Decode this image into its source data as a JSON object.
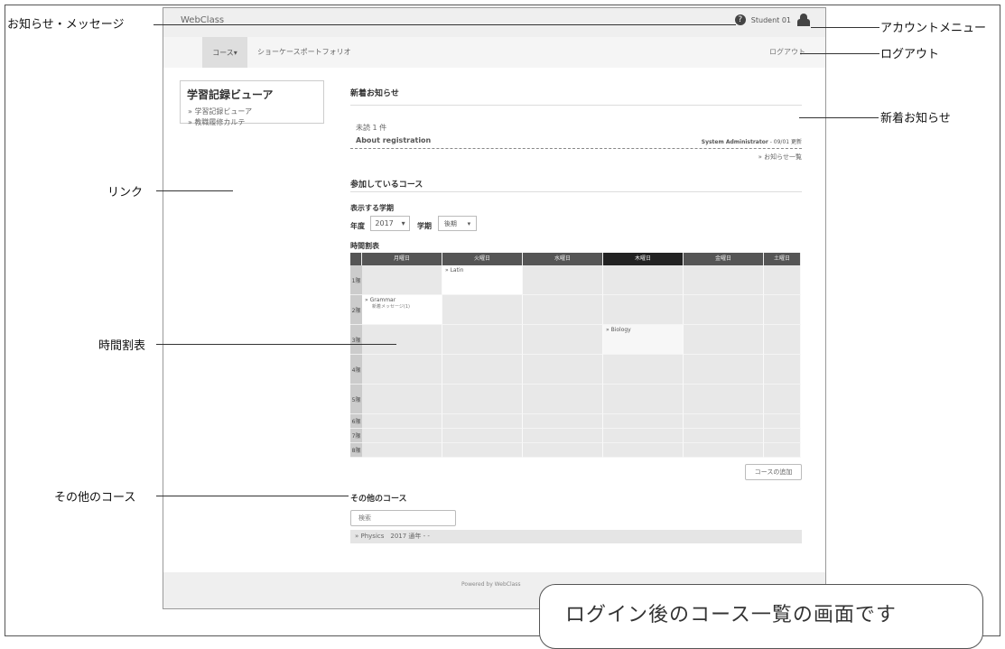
{
  "app": {
    "brand": "WebClass"
  },
  "account": {
    "user": "Student 01"
  },
  "nav": {
    "courses": "コース▾",
    "showcase": "ショーケースポートフォリオ",
    "logout": "ログアウト"
  },
  "sidebar": {
    "title": "学習記録ビューア",
    "links": [
      "» 学習記録ビューア",
      "» 教職履修カルテ"
    ]
  },
  "news": {
    "heading": "新着お知らせ",
    "unread": "未読 1 件",
    "item_title": "About registration",
    "item_author": "System Administrator",
    "item_meta": " - 09/01 更新",
    "list_link": "» お知らせ一覧"
  },
  "courses": {
    "heading": "参加しているコース",
    "term_heading": "表示する学期",
    "year_label": "年度",
    "year_value": "2017",
    "term_label": "学期",
    "term_value": "後期"
  },
  "timetable": {
    "heading": "時間割表",
    "days": [
      "月曜日",
      "火曜日",
      "水曜日",
      "木曜日",
      "金曜日",
      "土曜日"
    ],
    "periods": [
      "1限",
      "2限",
      "3限",
      "4限",
      "5限",
      "6限",
      "7限",
      "8限"
    ],
    "entries": {
      "mon_2": "» Grammar",
      "mon_2_sub": "新着メッセージ(1)",
      "tue_1": "» Latin",
      "thu_3": "» Biology"
    }
  },
  "add_course": "コースの追加",
  "other": {
    "heading": "その他のコース",
    "search_placeholder": "検索",
    "row": "» Physics　2017 通年 - -"
  },
  "footer": "Powered by WebClass",
  "annotations": {
    "news_messages": "お知らせ・メッセージ",
    "account_menu": "アカウントメニュー",
    "logout": "ログアウト",
    "new_notices": "新着お知らせ",
    "links": "リンク",
    "timetable": "時間割表",
    "other_courses": "その他のコース"
  },
  "callout": "ログイン後のコース一覧の画面です"
}
